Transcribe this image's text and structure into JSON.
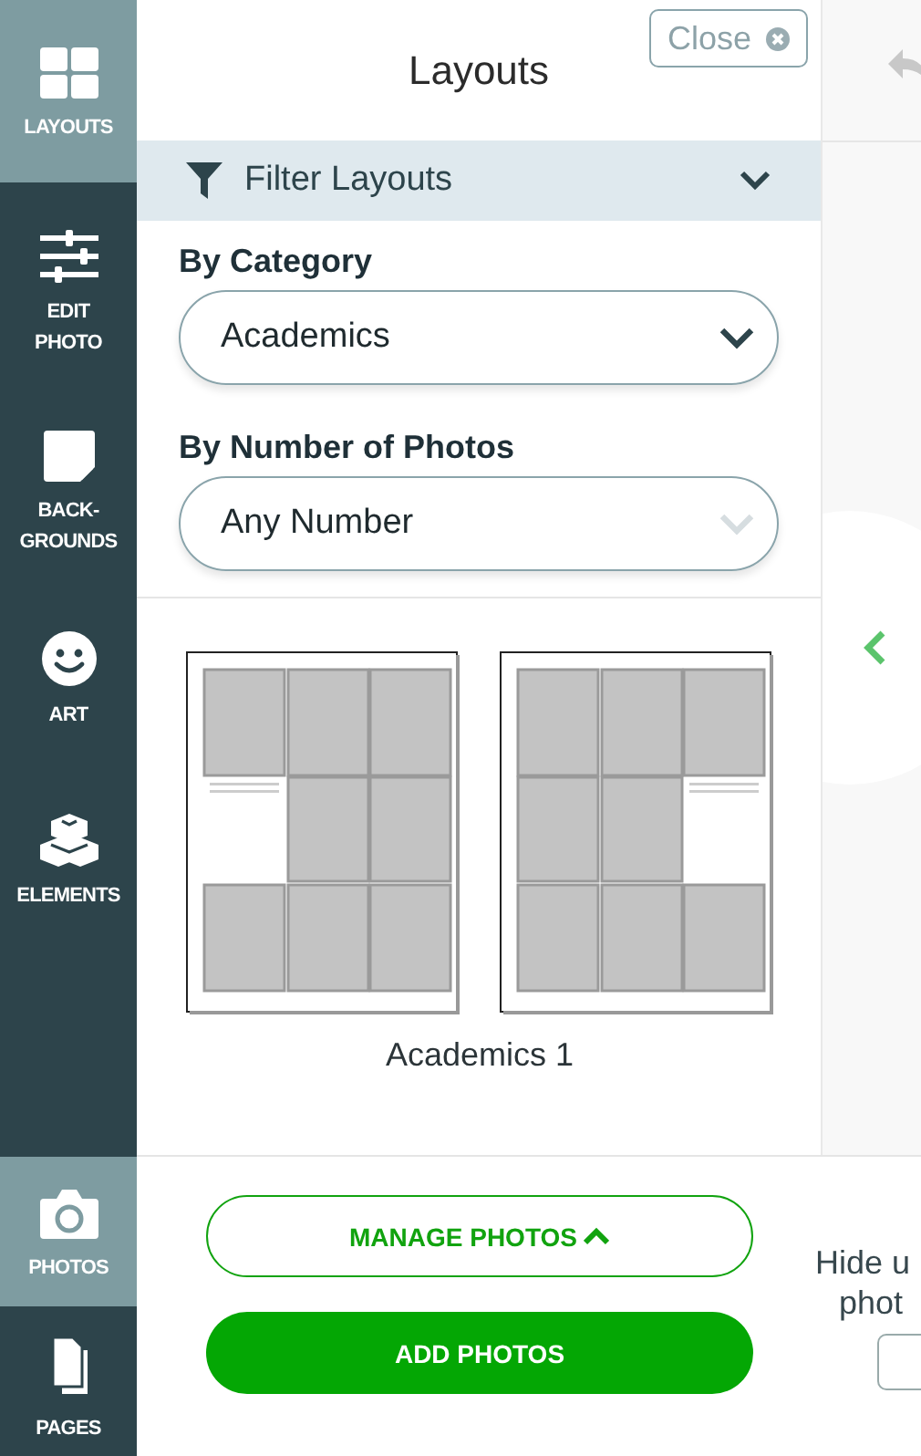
{
  "sidebar": {
    "items": [
      {
        "label": "LAYOUTS",
        "selected": true
      },
      {
        "label": "EDIT\nPHOTO",
        "selected": false
      },
      {
        "label": "BACK-\nGROUNDS",
        "selected": false
      },
      {
        "label": "ART",
        "selected": false
      },
      {
        "label": "ELEMENTS",
        "selected": false
      }
    ],
    "bottom_items": [
      {
        "label": "PHOTOS",
        "selected": true
      },
      {
        "label": "PAGES",
        "selected": false
      }
    ]
  },
  "panel": {
    "title": "Layouts",
    "close_button": "Close",
    "filter": {
      "title": "Filter Layouts",
      "fields": [
        {
          "label": "By Category",
          "value": "Academics",
          "disabled": false
        },
        {
          "label": "By Number of Photos",
          "value": "Any Number",
          "disabled": true
        }
      ]
    },
    "layouts": [
      {
        "name": "Academics 1"
      }
    ]
  },
  "bottom_bar": {
    "manage_button": "MANAGE PHOTOS",
    "add_button": "ADD PHOTOS",
    "hint_lines": [
      "Hide u",
      "phot"
    ]
  }
}
